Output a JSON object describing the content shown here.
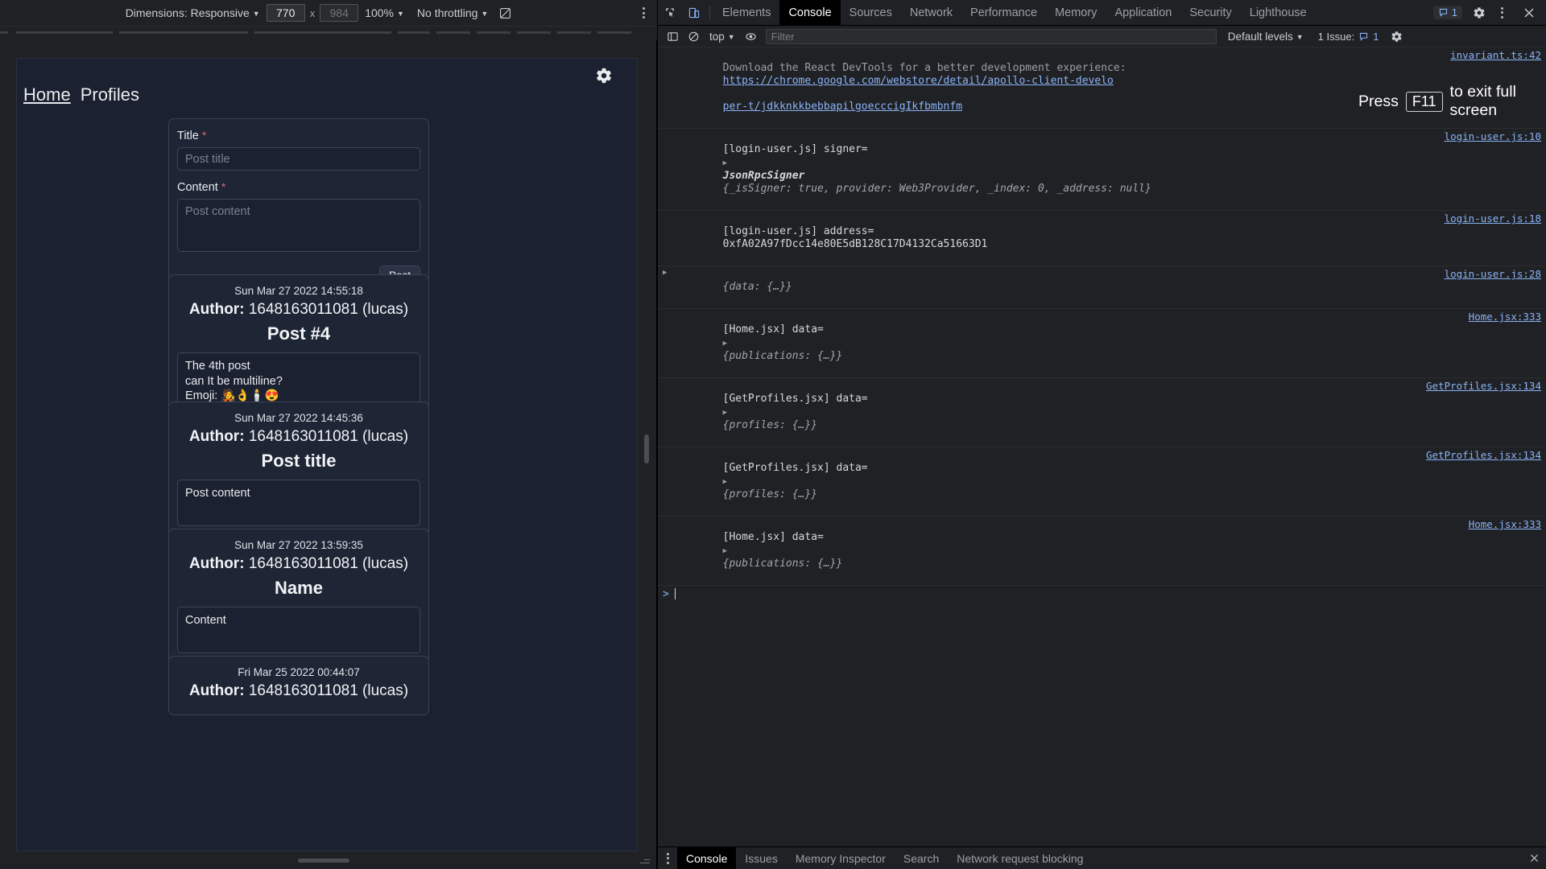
{
  "device_toolbar": {
    "dimensions_label": "Dimensions: Responsive",
    "width_value": "770",
    "height_placeholder": "984",
    "times": "x",
    "zoom_label": "100%",
    "throttling_label": "No throttling",
    "rotate_icon": "rotate-icon",
    "more_icon": "more-options-icon"
  },
  "page": {
    "gear_icon": "gear-icon",
    "nav": {
      "home": "Home",
      "profiles": "Profiles"
    },
    "form": {
      "title_label": "Title",
      "title_required": "*",
      "title_placeholder": "Post title",
      "title_value": "",
      "content_label": "Content",
      "content_required": "*",
      "content_placeholder": "Post content",
      "content_value": "",
      "post_button": "Post"
    },
    "posts": [
      {
        "date": "Sun Mar 27 2022 14:55:18",
        "author_label": "Author:",
        "author": "1648163011081 (lucas)",
        "title": "Post #4",
        "body": "The 4th post\ncan It be multiline?\nEmoji: 🧑‍🎤👌🕯️😍"
      },
      {
        "date": "Sun Mar 27 2022 14:45:36",
        "author_label": "Author:",
        "author": "1648163011081 (lucas)",
        "title": "Post title",
        "body": "Post content"
      },
      {
        "date": "Sun Mar 27 2022 13:59:35",
        "author_label": "Author:",
        "author": "1648163011081 (lucas)",
        "title": "Name",
        "body": "Content"
      },
      {
        "date": "Fri Mar 25 2022 00:44:07",
        "author_label": "Author:",
        "author": "1648163011081 (lucas)",
        "title": "",
        "body": ""
      }
    ]
  },
  "devtools": {
    "inspect_icon": "inspect-element-icon",
    "device_toggle_icon": "device-toolbar-icon",
    "tabs": [
      {
        "label": "Elements",
        "active": false
      },
      {
        "label": "Console",
        "active": true
      },
      {
        "label": "Sources",
        "active": false
      },
      {
        "label": "Network",
        "active": false
      },
      {
        "label": "Performance",
        "active": false
      },
      {
        "label": "Memory",
        "active": false
      },
      {
        "label": "Application",
        "active": false
      },
      {
        "label": "Security",
        "active": false
      },
      {
        "label": "Lighthouse",
        "active": false
      }
    ],
    "issue_count": "1",
    "issue_badge_icon": "issue-message-icon",
    "settings_icon": "gear-icon",
    "more_icon": "more-options-icon",
    "close_icon": "close-icon"
  },
  "console_toolbar": {
    "sidebar_icon": "console-sidebar-icon",
    "clear_icon": "clear-console-icon",
    "context_label": "top",
    "eye_icon": "live-expression-icon",
    "filter_placeholder": "Filter",
    "filter_value": "",
    "levels_label": "Default levels",
    "issues_label": "1 Issue:",
    "issues_count": "1",
    "issues_icon": "issue-message-icon",
    "settings_icon": "console-settings-icon"
  },
  "fullscreen_toast": {
    "before": "Press",
    "key": "F11",
    "after": "to exit full screen"
  },
  "console_logs": [
    {
      "type": "warning",
      "text_before": "Download the React DevTools for a better development experience:",
      "link": "https://chrome.google.com/webstore/detail/apollo-client-develo",
      "link_second": "per-t/jdkknkkbebbapilgoecccigIkfbmbnfm",
      "source": "invariant.ts:42"
    },
    {
      "type": "log",
      "prefix": "[login-user.js] signer=",
      "object_class": "JsonRpcSigner",
      "object_preview": "{_isSigner: true, provider: Web3Provider, _index: 0, _address: null}",
      "source": "login-user.js:10"
    },
    {
      "type": "log",
      "prefix": "[login-user.js] address=",
      "value": "0xfA02A97fDcc14e80E5dB128C17D4132Ca51663D1",
      "source": "login-user.js:18"
    },
    {
      "type": "log",
      "prefix": "",
      "object_preview": "{data: {…}}",
      "source": "login-user.js:28"
    },
    {
      "type": "log",
      "prefix": "[Home.jsx] data=",
      "object_preview": "{publications: {…}}",
      "source": "Home.jsx:333"
    },
    {
      "type": "log",
      "prefix": "[GetProfiles.jsx] data=",
      "object_preview": "{profiles: {…}}",
      "source": "GetProfiles.jsx:134"
    },
    {
      "type": "log",
      "prefix": "[GetProfiles.jsx] data=",
      "object_preview": "{profiles: {…}}",
      "source": "GetProfiles.jsx:134"
    },
    {
      "type": "log",
      "prefix": "[Home.jsx] data=",
      "object_preview": "{publications: {…}}",
      "source": "Home.jsx:333"
    }
  ],
  "console_prompt": {
    "arrow": ">"
  },
  "drawer": {
    "more_icon": "more-options-icon",
    "tabs": [
      {
        "label": "Console",
        "active": true
      },
      {
        "label": "Issues",
        "active": false
      },
      {
        "label": "Memory Inspector",
        "active": false
      },
      {
        "label": "Search",
        "active": false
      },
      {
        "label": "Network request blocking",
        "active": false
      }
    ],
    "close_icon": "close-icon"
  },
  "colors": {
    "devtools_bg": "#202124",
    "page_bg": "#1b2130",
    "accent_link": "#8ab4f8",
    "required_red": "#d9636e",
    "token_purple": "#9980ff"
  }
}
